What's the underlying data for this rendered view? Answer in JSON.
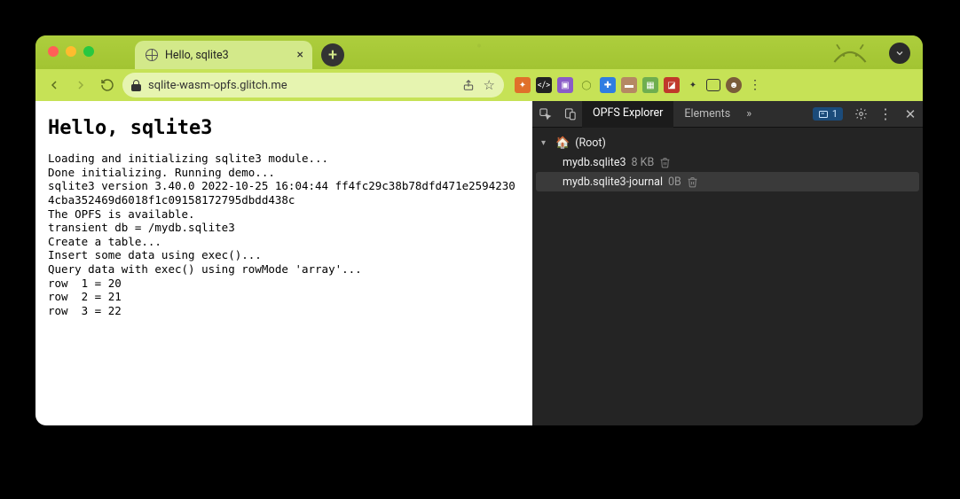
{
  "browser": {
    "tab_title": "Hello, sqlite3",
    "url": "sqlite-wasm-opfs.glitch.me",
    "nav": {
      "back": "Back",
      "forward": "Forward",
      "reload": "Reload"
    },
    "newtab": "+",
    "close_tab": "×"
  },
  "page": {
    "heading": "Hello, sqlite3",
    "lines": [
      "Loading and initializing sqlite3 module...",
      "Done initializing. Running demo...",
      "sqlite3 version 3.40.0 2022-10-25 16:04:44 ff4fc29c38b78dfd471e25942304cba352469d6018f1c09158172795dbdd438c",
      "The OPFS is available.",
      "transient db = /mydb.sqlite3",
      "Create a table...",
      "Insert some data using exec()...",
      "Query data with exec() using rowMode 'array'...",
      "row  1 = 20",
      "row  2 = 21",
      "row  3 = 22"
    ]
  },
  "devtools": {
    "tabs": {
      "active": "OPFS Explorer",
      "other": "Elements",
      "more": "»"
    },
    "issues_count": "1",
    "tree": {
      "root_label": "(Root)",
      "rows": [
        {
          "name": "mydb.sqlite3",
          "size": "8 KB"
        },
        {
          "name": "mydb.sqlite3-journal",
          "size": "0B"
        }
      ]
    }
  },
  "ext_colors": [
    "#e0702a",
    "#222",
    "#8a5cc7",
    "#9bd24a",
    "#2f7de1",
    "#b58863",
    "#6fae4f",
    "#c0392b",
    "#333",
    "#444",
    "#7a5c3a"
  ]
}
